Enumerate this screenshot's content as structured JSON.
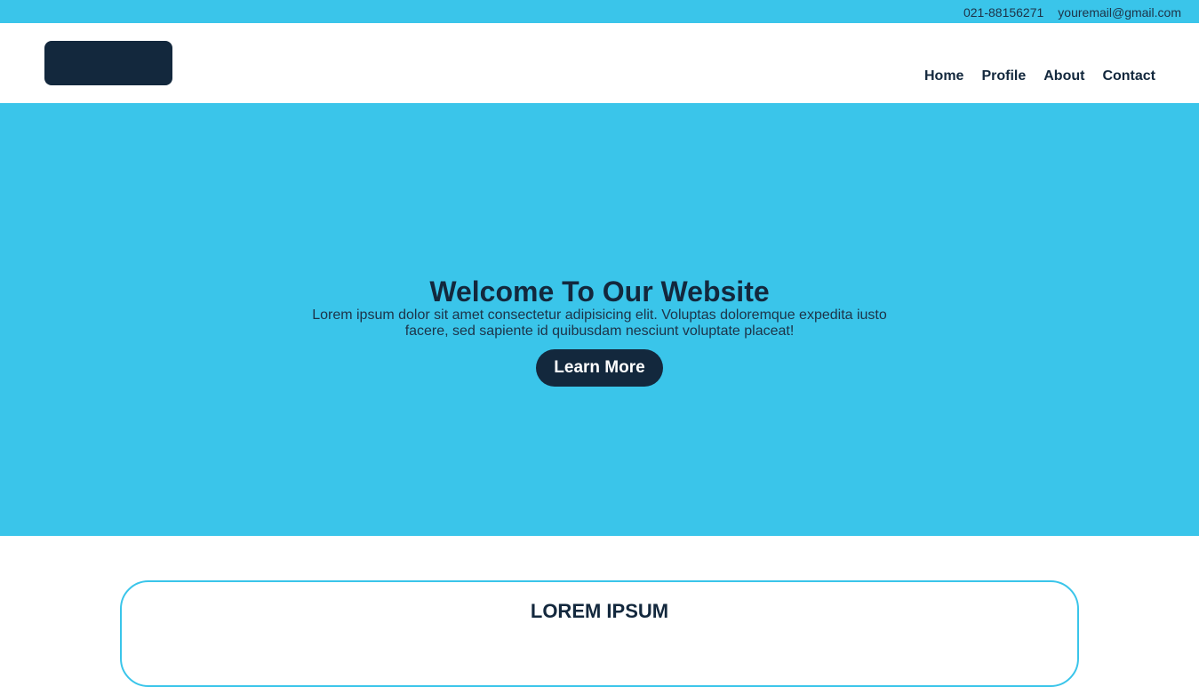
{
  "topbar": {
    "phone": "021-88156271",
    "email": "youremail@gmail.com"
  },
  "nav": {
    "items": [
      {
        "label": "Home"
      },
      {
        "label": "Profile"
      },
      {
        "label": "About"
      },
      {
        "label": "Contact"
      }
    ]
  },
  "hero": {
    "title": "Welcome To Our Website",
    "text": "Lorem ipsum dolor sit amet consectetur adipisicing elit. Voluptas doloremque expedita iusto facere, sed sapiente id quibusdam nesciunt voluptate placeat!",
    "button_label": "Learn More"
  },
  "section": {
    "title": "LOREM IPSUM"
  },
  "colors": {
    "accent": "#3ac5ea",
    "dark": "#13283d",
    "background": "#ffffff"
  }
}
